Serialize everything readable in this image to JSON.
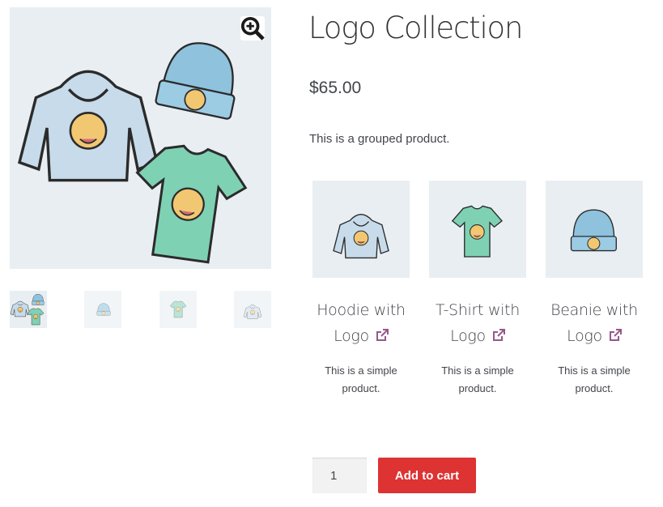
{
  "product": {
    "title": "Logo Collection",
    "price": "$65.00",
    "description": "This is a grouped product."
  },
  "gallery": {
    "main_image": "logo-collection-image",
    "thumbnails": [
      "logo-collection",
      "beanie",
      "t-shirt",
      "hoodie"
    ]
  },
  "grouped_items": [
    {
      "name_line1": "Hoodie with",
      "name_line2": "Logo",
      "description_line1": "This is a simple",
      "description_line2": "product."
    },
    {
      "name_line1": "T-Shirt with",
      "name_line2": "Logo",
      "description_line1": "This is a simple",
      "description_line2": "product."
    },
    {
      "name_line1": "Beanie with",
      "name_line2": "Logo",
      "description_line1": "This is a simple",
      "description_line2": "product."
    }
  ],
  "cart": {
    "quantity": "1",
    "add_label": "Add to cart"
  },
  "colors": {
    "button": "#dd3333",
    "link_icon": "#96588a",
    "image_bg": "#e9eef2"
  },
  "icons": {
    "zoom": "zoom-icon",
    "external_link": "external-link-icon"
  }
}
